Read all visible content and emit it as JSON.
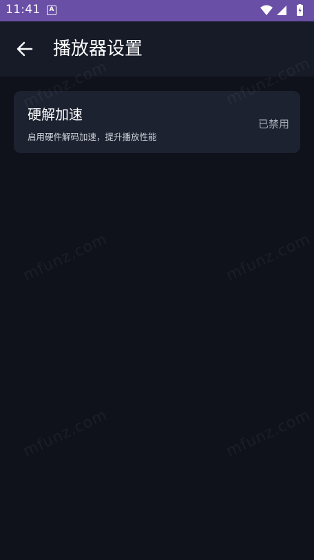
{
  "status_bar": {
    "time": "11:41",
    "notification_icon_letter": "A",
    "icons": [
      "wifi-icon",
      "signal-icon",
      "battery-icon"
    ]
  },
  "app_bar": {
    "title": "播放器设置",
    "back_icon": "arrow-back-icon"
  },
  "settings": {
    "hardware_decoding": {
      "title": "硬解加速",
      "description": "启用硬件解码加速，提升播放性能",
      "status": "已禁用"
    }
  },
  "watermark": {
    "text": "mfunz.com"
  },
  "colors": {
    "status_bar": "#6a4fa6",
    "app_bar": "#161b27",
    "background": "#0f121b",
    "card": "#1c2230"
  }
}
